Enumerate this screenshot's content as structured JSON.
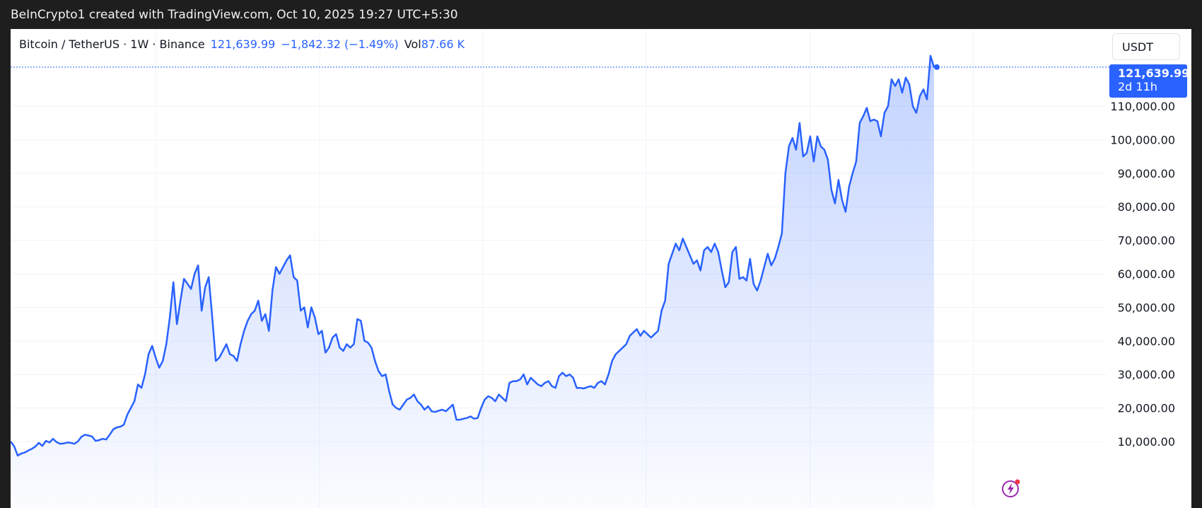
{
  "header": {
    "title": "BeInCrypto1 created with TradingView.com, Oct 10, 2025 19:27 UTC+5:30"
  },
  "legend": {
    "symbol": "Bitcoin / TetherUS · 1W · Binance",
    "price": "121,639.99",
    "change": "−1,842.32 (−1.49%)",
    "vol_label": "Vol",
    "vol_value": "87.66 K"
  },
  "unit_button": "USDT",
  "price_tag": {
    "price": "121,639.99",
    "countdown": "2d 11h"
  },
  "colors": {
    "line": "#2962ff",
    "tag": "#2962ff",
    "background": "#ffffff"
  },
  "icons": {
    "flash": "lightning-icon"
  },
  "chart_data": {
    "type": "area",
    "title": "",
    "xlabel": "",
    "ylabel": "",
    "y_axis_side": "right",
    "ylim": [
      3000,
      123500
    ],
    "grid": true,
    "y_ticks": [
      "10,000.00",
      "20,000.00",
      "30,000.00",
      "40,000.00",
      "50,000.00",
      "60,000.00",
      "70,000.00",
      "80,000.00",
      "90,000.00",
      "100,000.00",
      "110,000.00"
    ],
    "y_tick_values": [
      10000,
      20000,
      30000,
      40000,
      50000,
      60000,
      70000,
      80000,
      90000,
      100000,
      110000
    ],
    "last_price": 121639.99,
    "x_index_range": [
      0,
      255
    ],
    "series": [
      {
        "values": [
          10000,
          8600,
          5800,
          6400,
          6700,
          7300,
          7800,
          8500,
          9600,
          8700,
          10200,
          9700,
          10800,
          9800,
          9300,
          9400,
          9700,
          9600,
          9300,
          10000,
          11400,
          12000,
          11800,
          11500,
          10200,
          10400,
          10800,
          10600,
          12000,
          13600,
          14200,
          14400,
          15000,
          18000,
          20000,
          22000,
          27000,
          26000,
          30000,
          36000,
          38500,
          35000,
          32000,
          34000,
          39000,
          47000,
          57500,
          45000,
          52000,
          58500,
          57000,
          55500,
          60000,
          62500,
          49000,
          56000,
          59000,
          47000,
          34000,
          35000,
          37000,
          39000,
          36000,
          35500,
          34000,
          39000,
          43000,
          46000,
          48000,
          49000,
          52000,
          46000,
          48000,
          43000,
          55000,
          62000,
          60000,
          62000,
          64000,
          65500,
          59000,
          58000,
          49000,
          50000,
          44000,
          50000,
          47000,
          42000,
          43000,
          36500,
          38000,
          41000,
          42000,
          38000,
          37000,
          39000,
          38000,
          39000,
          46500,
          46000,
          40000,
          39500,
          38000,
          34000,
          31000,
          29500,
          30000,
          25000,
          21000,
          20000,
          19500,
          21000,
          22500,
          23000,
          24000,
          22000,
          21000,
          19500,
          20500,
          19000,
          18800,
          19200,
          19500,
          19000,
          20000,
          21000,
          16500,
          16500,
          16800,
          17000,
          17500,
          16800,
          17000,
          20000,
          22500,
          23500,
          23000,
          22000,
          24000,
          23000,
          22000,
          27500,
          28000,
          28000,
          28500,
          30000,
          27000,
          29000,
          28000,
          27000,
          26500,
          27500,
          28000,
          26500,
          26000,
          29500,
          30500,
          29500,
          30000,
          29000,
          26000,
          26000,
          25800,
          26200,
          26500,
          26000,
          27500,
          28000,
          27000,
          30000,
          34000,
          36000,
          37000,
          38000,
          39000,
          41500,
          42500,
          43500,
          41500,
          43000,
          42000,
          41000,
          42000,
          43000,
          49000,
          52000,
          63000,
          66000,
          69000,
          67000,
          70500,
          68000,
          65500,
          63000,
          64000,
          61000,
          67000,
          68000,
          66500,
          69000,
          66500,
          61000,
          56000,
          57500,
          66500,
          68000,
          58500,
          59000,
          58000,
          64500,
          57000,
          55000,
          58000,
          62000,
          66000,
          62500,
          64500,
          68000,
          72000,
          90000,
          98000,
          100500,
          97000,
          105000,
          95000,
          96000,
          101000,
          93500,
          101000,
          98000,
          97000,
          94000,
          85000,
          81000,
          88000,
          82000,
          78500,
          86000,
          90000,
          93500,
          105000,
          107000,
          109500,
          105500,
          106000,
          105500,
          101000,
          108000,
          110000,
          118000,
          116000,
          118000,
          114000,
          118500,
          116500,
          110000,
          108000,
          113000,
          115000,
          112000,
          125000,
          121639.99
        ]
      }
    ]
  }
}
